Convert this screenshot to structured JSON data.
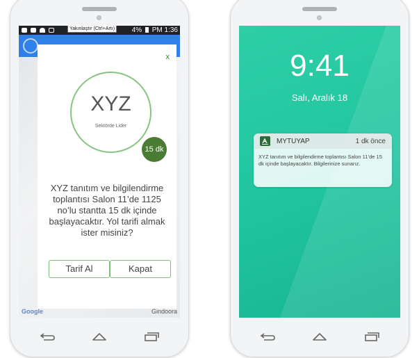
{
  "left_phone": {
    "statusbar": {
      "tooltip": "Yakınlaştır (Ctrl+Artı)",
      "battery": "4%",
      "time_suffix": "PM 1:36"
    },
    "map": {
      "google_label": "Google",
      "indoor_label": "Gindoora"
    },
    "dialog": {
      "close": "x",
      "logo_title": "XYZ",
      "logo_subtitle": "Sektörde Lider",
      "badge": "15 dk",
      "message": "XYZ tanıtım ve bilgilendirme toplantısı Salon 11’de 1125 no’lu stantta 15 dk içinde başlayacaktır. Yol tarifi almak ister misiniz?",
      "button_directions": "Tarif Al",
      "button_close": "Kapat"
    }
  },
  "right_phone": {
    "clock": "9:41",
    "date": "Salı, Aralık 18",
    "notification": {
      "app": "MYTUYAP",
      "time": "1 dk önce",
      "body": "XYZ tanıtım ve bilgilendirme toplantısı Salon 11’de 15 dk içinde başlayacaktır. Bilgilerinize sunarız."
    }
  },
  "colors": {
    "accent_green": "#4a7c33",
    "ring_green": "#86c580",
    "lock_teal": "#21c49f",
    "appbar_blue": "#2f80e8"
  }
}
